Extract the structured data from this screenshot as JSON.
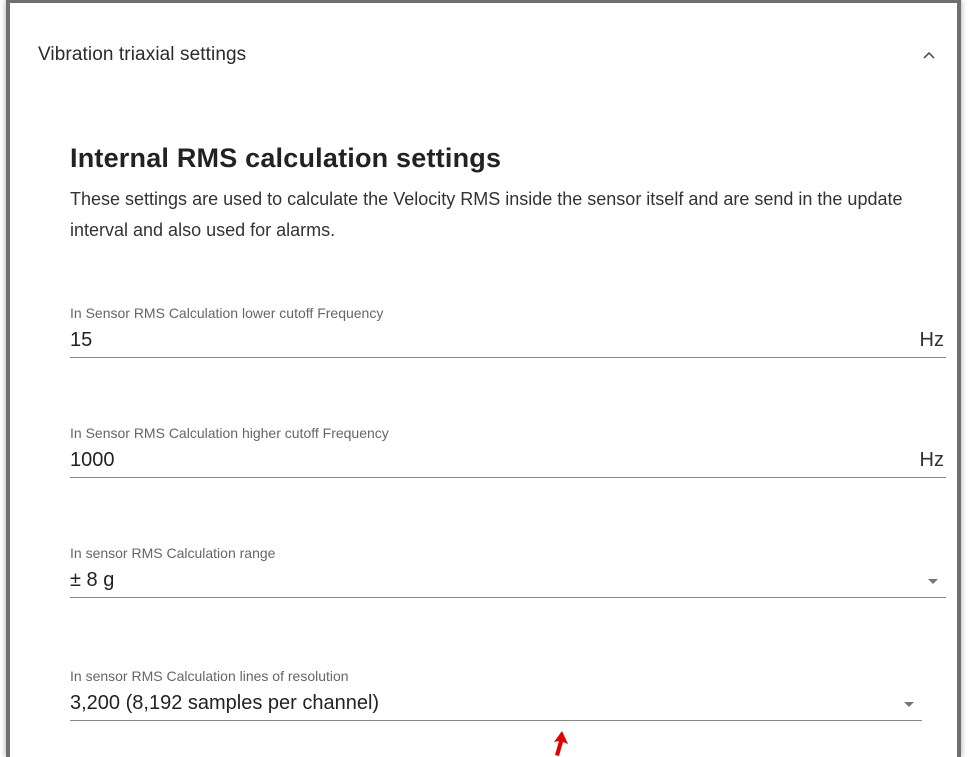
{
  "panel": {
    "title": "Vibration triaxial settings",
    "expanded_icon": "chevron-up-icon"
  },
  "section": {
    "title": "Internal RMS calculation settings",
    "description": "These settings are used to calculate the Velocity RMS inside the sensor itself and are send in the update interval and also used for alarms."
  },
  "fields": [
    {
      "label": "In Sensor RMS Calculation lower cutoff Frequency",
      "value": "15",
      "suffix": "Hz"
    },
    {
      "label": "In Sensor RMS Calculation higher cutoff Frequency",
      "value": "1000",
      "suffix": "Hz"
    },
    {
      "label": "In sensor RMS Calculation range",
      "value": "± 8 g"
    },
    {
      "label": "In sensor RMS Calculation lines of resolution",
      "value": "3,200 (8,192 samples per channel)"
    }
  ],
  "colors": {
    "cursor": "#e00000",
    "frame_border": "#6f6f6f"
  }
}
